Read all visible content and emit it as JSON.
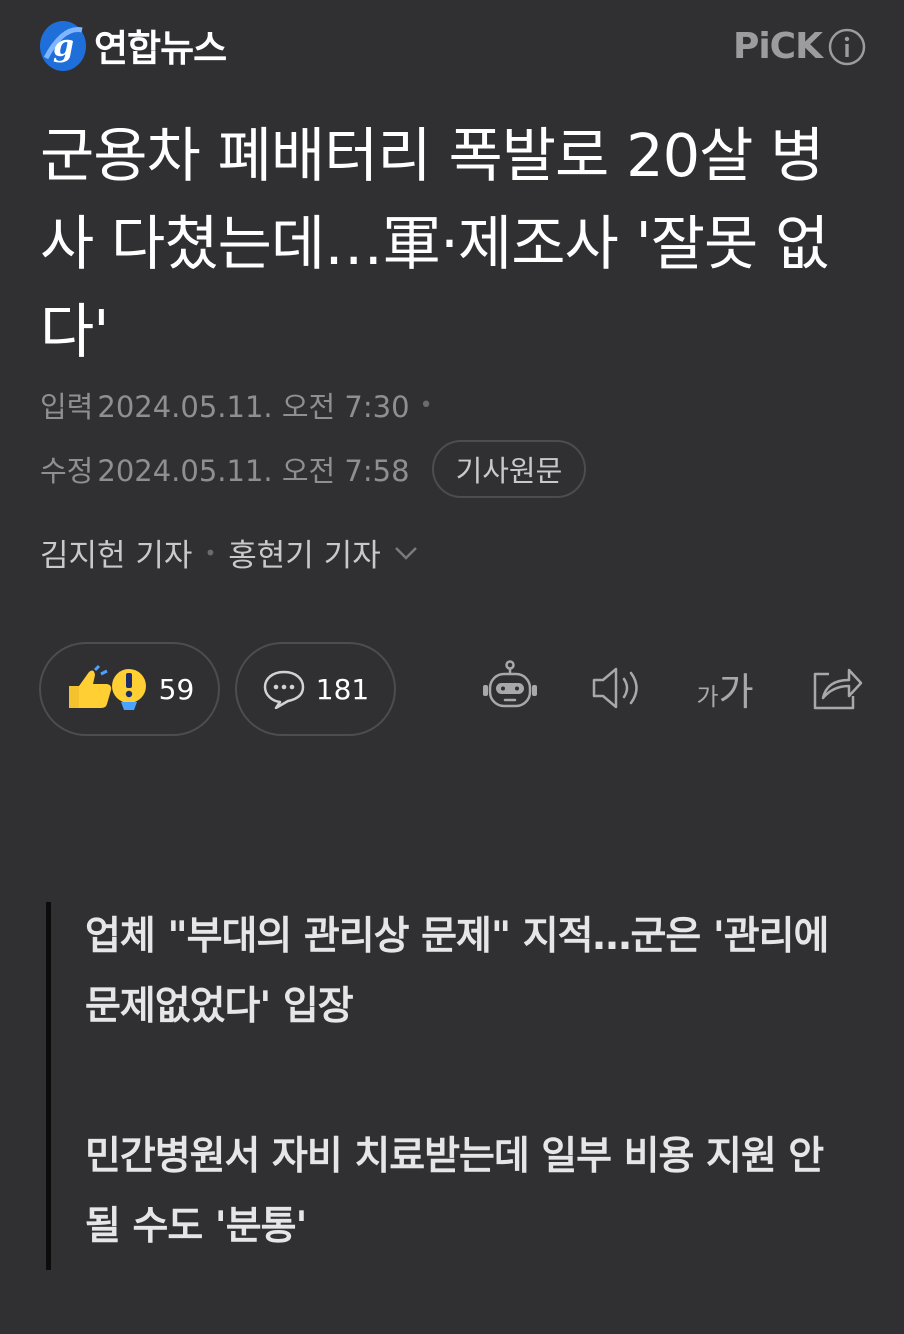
{
  "header": {
    "logo_text": "연합뉴스",
    "logo_icon": "yonhap-globe-logo",
    "pick_label": "PiCK",
    "pick_icon": "info-circle-icon",
    "logo_color": "#1e6fd9"
  },
  "article": {
    "title": "군용차 폐배터리 폭발로 20살 병사 다쳤는데…軍·제조사 '잘못 없다'",
    "input_label": "입력",
    "input_time": "2024.05.11. 오전 7:30",
    "edit_label": "수정",
    "edit_time": "2024.05.11. 오전 7:58",
    "source_button": "기사원문",
    "authors": [
      "김지헌 기자",
      "홍현기 기자"
    ]
  },
  "actions": {
    "reaction_count": "59",
    "comment_count": "181",
    "reaction_icon": "thumbs-up-surprise-emoji",
    "comment_icon": "speech-bubble-icon",
    "tools": [
      "ai-summary-bot-icon",
      "speaker-icon",
      "font-size-icon",
      "share-icon"
    ],
    "font_size_small": "가",
    "font_size_large": "가"
  },
  "summary": [
    "업체 \"부대의 관리상 문제\" 지적…군은 '관리에 문제없었다' 입장",
    "민간병원서 자비 치료받는데 일부 비용 지원 안될 수도 '분통'"
  ]
}
